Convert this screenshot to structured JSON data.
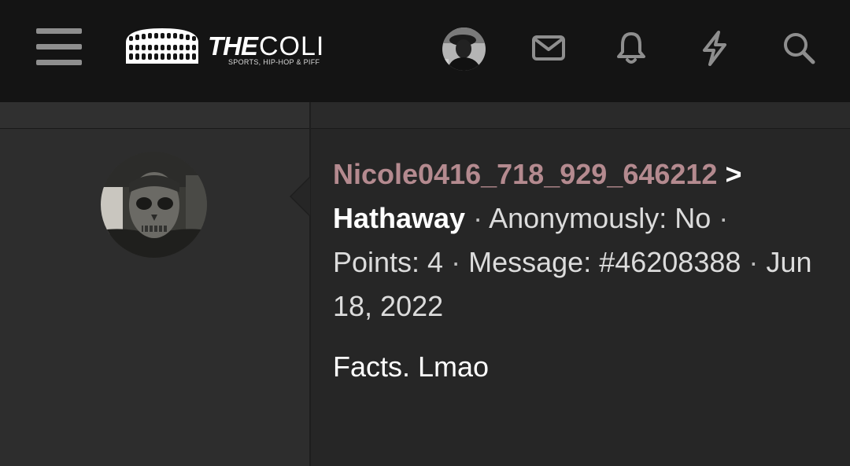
{
  "header": {
    "logo": {
      "the": "THE",
      "coli": "COLI",
      "tagline": "SPORTS, HIP-HOP & PIFF"
    },
    "icons": [
      "menu-icon",
      "user-avatar",
      "envelope-icon",
      "bell-icon",
      "lightning-icon",
      "search-icon"
    ]
  },
  "post": {
    "author": "Nicole0416_718_929_646212",
    "arrow": ">",
    "recipient": "Hathaway",
    "separator": "·",
    "anonymous": "Anonymously: No",
    "points": "Points: 4",
    "message_id": "Message: #46208388",
    "date": "Jun 18, 2022",
    "message": "Facts. Lmao"
  },
  "colors": {
    "header_bg": "#141414",
    "page_bg": "#262626",
    "author": "#b48a8f",
    "text": "#dcdcdc",
    "icon": "#8e8e8e"
  }
}
